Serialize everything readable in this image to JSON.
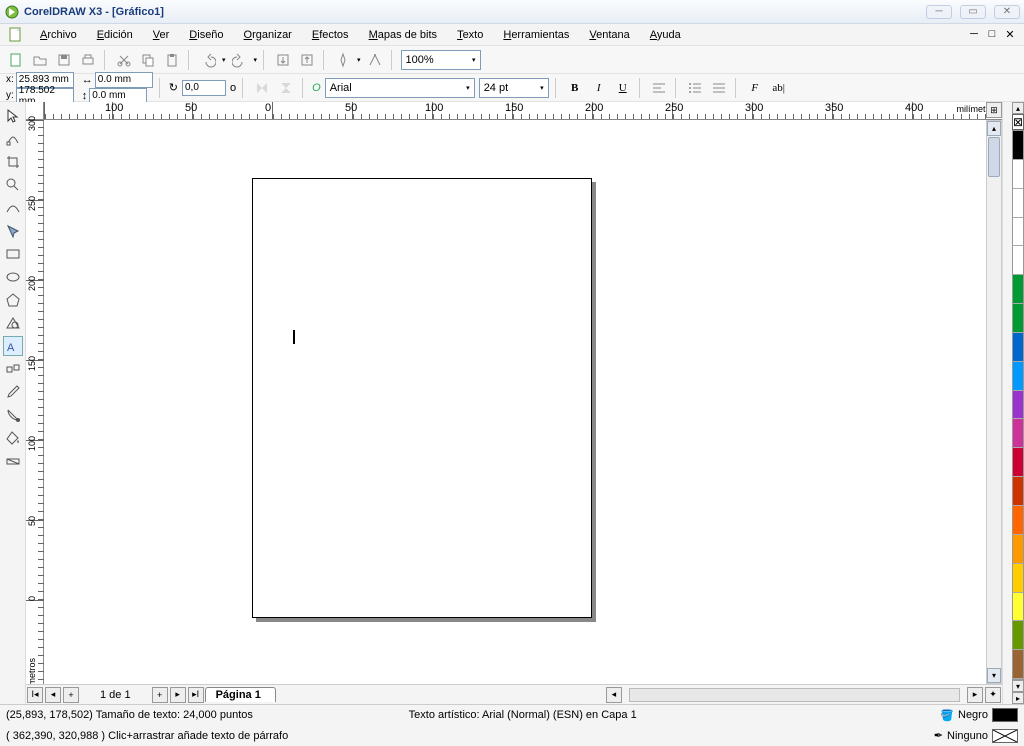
{
  "title": "CorelDRAW X3 - [Gráfico1]",
  "menu": [
    "Archivo",
    "Edición",
    "Ver",
    "Diseño",
    "Organizar",
    "Efectos",
    "Mapas de bits",
    "Texto",
    "Herramientas",
    "Ventana",
    "Ayuda"
  ],
  "menu_hotkeys": [
    "A",
    "E",
    "V",
    "D",
    "O",
    "E",
    "M",
    "T",
    "H",
    "V",
    "A"
  ],
  "zoom": "100%",
  "prop": {
    "x_label": "x:",
    "y_label": "y:",
    "x": "25.893 mm",
    "y": "178.502 mm",
    "w": "0.0 mm",
    "h": "0.0 mm",
    "rotation": "0,0",
    "deg": "o",
    "font_icon": "O",
    "font": "Arial",
    "fontsize": "24 pt",
    "btns": {
      "bold": "B",
      "italic": "I",
      "underline": "U",
      "ablcursor": "ab|"
    },
    "f_text": "F"
  },
  "ruler_unit": "milímetros",
  "hruler_vals": [
    "0",
    "100",
    "50",
    "0",
    "50",
    "100",
    "150",
    "200",
    "250",
    "300",
    "350",
    "400"
  ],
  "vruler_vals": [
    "300",
    "250",
    "200",
    "150",
    "100",
    "50",
    "0"
  ],
  "pagenav": {
    "count": "1 de 1",
    "tab": "Página 1"
  },
  "status": {
    "row1_left": "(25,893, 178,502)  Tamaño de texto: 24,000 puntos",
    "row1_mid": "Texto artístico: Arial (Normal) (ESN) en Capa 1",
    "row1_fill": "Negro",
    "row2_left": "( 362,390, 320,988 )   Clic+arrastrar añade texto de párrafo",
    "row2_fill": "Ninguno"
  },
  "palette_colors": [
    "#000000",
    "#ffffff",
    "#ffffff",
    "#ffffff",
    "#ffffff",
    "#009933",
    "#009933",
    "#0066cc",
    "#0099ff",
    "#9933cc",
    "#cc3399",
    "#cc0033",
    "#cc3300",
    "#ff6600",
    "#ff9900",
    "#ffcc00",
    "#ffff33",
    "#669900",
    "#996633"
  ]
}
